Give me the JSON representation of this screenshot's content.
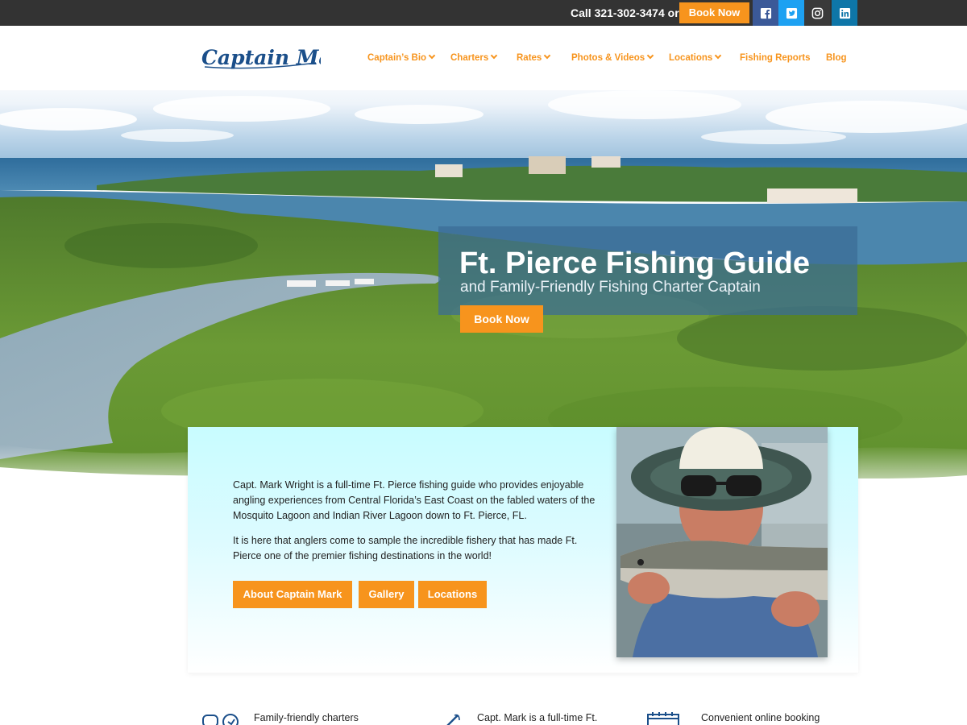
{
  "topbar": {
    "call_text": "Call 321-302-3474 or",
    "book_label": "Book Now",
    "social": [
      {
        "icon": "facebook-icon",
        "color": "#3b5998"
      },
      {
        "icon": "twitter-icon",
        "color": "#1da1f2"
      },
      {
        "icon": "instagram-icon",
        "color": "#3a3a3a"
      },
      {
        "icon": "linkedin-icon",
        "color": "#0e76a8"
      }
    ]
  },
  "header": {
    "logo_text": "Captain Mark",
    "nav": [
      {
        "label": "Captain’s Bio",
        "dropdown": true
      },
      {
        "label": "Charters",
        "dropdown": true
      },
      {
        "label": "Rates",
        "dropdown": true
      },
      {
        "label": "Photos & Videos",
        "dropdown": true
      },
      {
        "label": "Locations",
        "dropdown": true
      },
      {
        "label": "Fishing Reports",
        "dropdown": false
      },
      {
        "label": "Blog",
        "dropdown": false
      }
    ]
  },
  "hero": {
    "title": "Ft. Pierce Fishing Guide",
    "subtitle": "and Family-Friendly Fishing Charter Captain",
    "book_label": "Book Now"
  },
  "intro": {
    "paragraph_1": "Capt. Mark Wright is a full-time Ft. Pierce fishing guide who provides enjoyable angling experiences from Central Florida’s East Coast on the fabled waters of the Mosquito Lagoon and Indian River Lagoon down to Ft. Pierce, FL.",
    "paragraph_2": "It is here that anglers come to sample the incredible fishery that has made Ft. Pierce one of the premier fishing destinations in the world!",
    "buttons": [
      "About Captain Mark",
      "Gallery",
      "Locations"
    ]
  },
  "features": [
    {
      "icon": "family-icon",
      "text": "Family-friendly charters"
    },
    {
      "icon": "fishing-rod-icon",
      "text": "Capt. Mark is a full-time Ft."
    },
    {
      "icon": "calendar-icon",
      "text": "Convenient online booking"
    }
  ],
  "colors": {
    "accent": "#f7941d",
    "topbar": "#333333",
    "logo": "#1b4f8a",
    "hero_box": "#3a6c96",
    "intro_bg": "#c8fcff"
  }
}
